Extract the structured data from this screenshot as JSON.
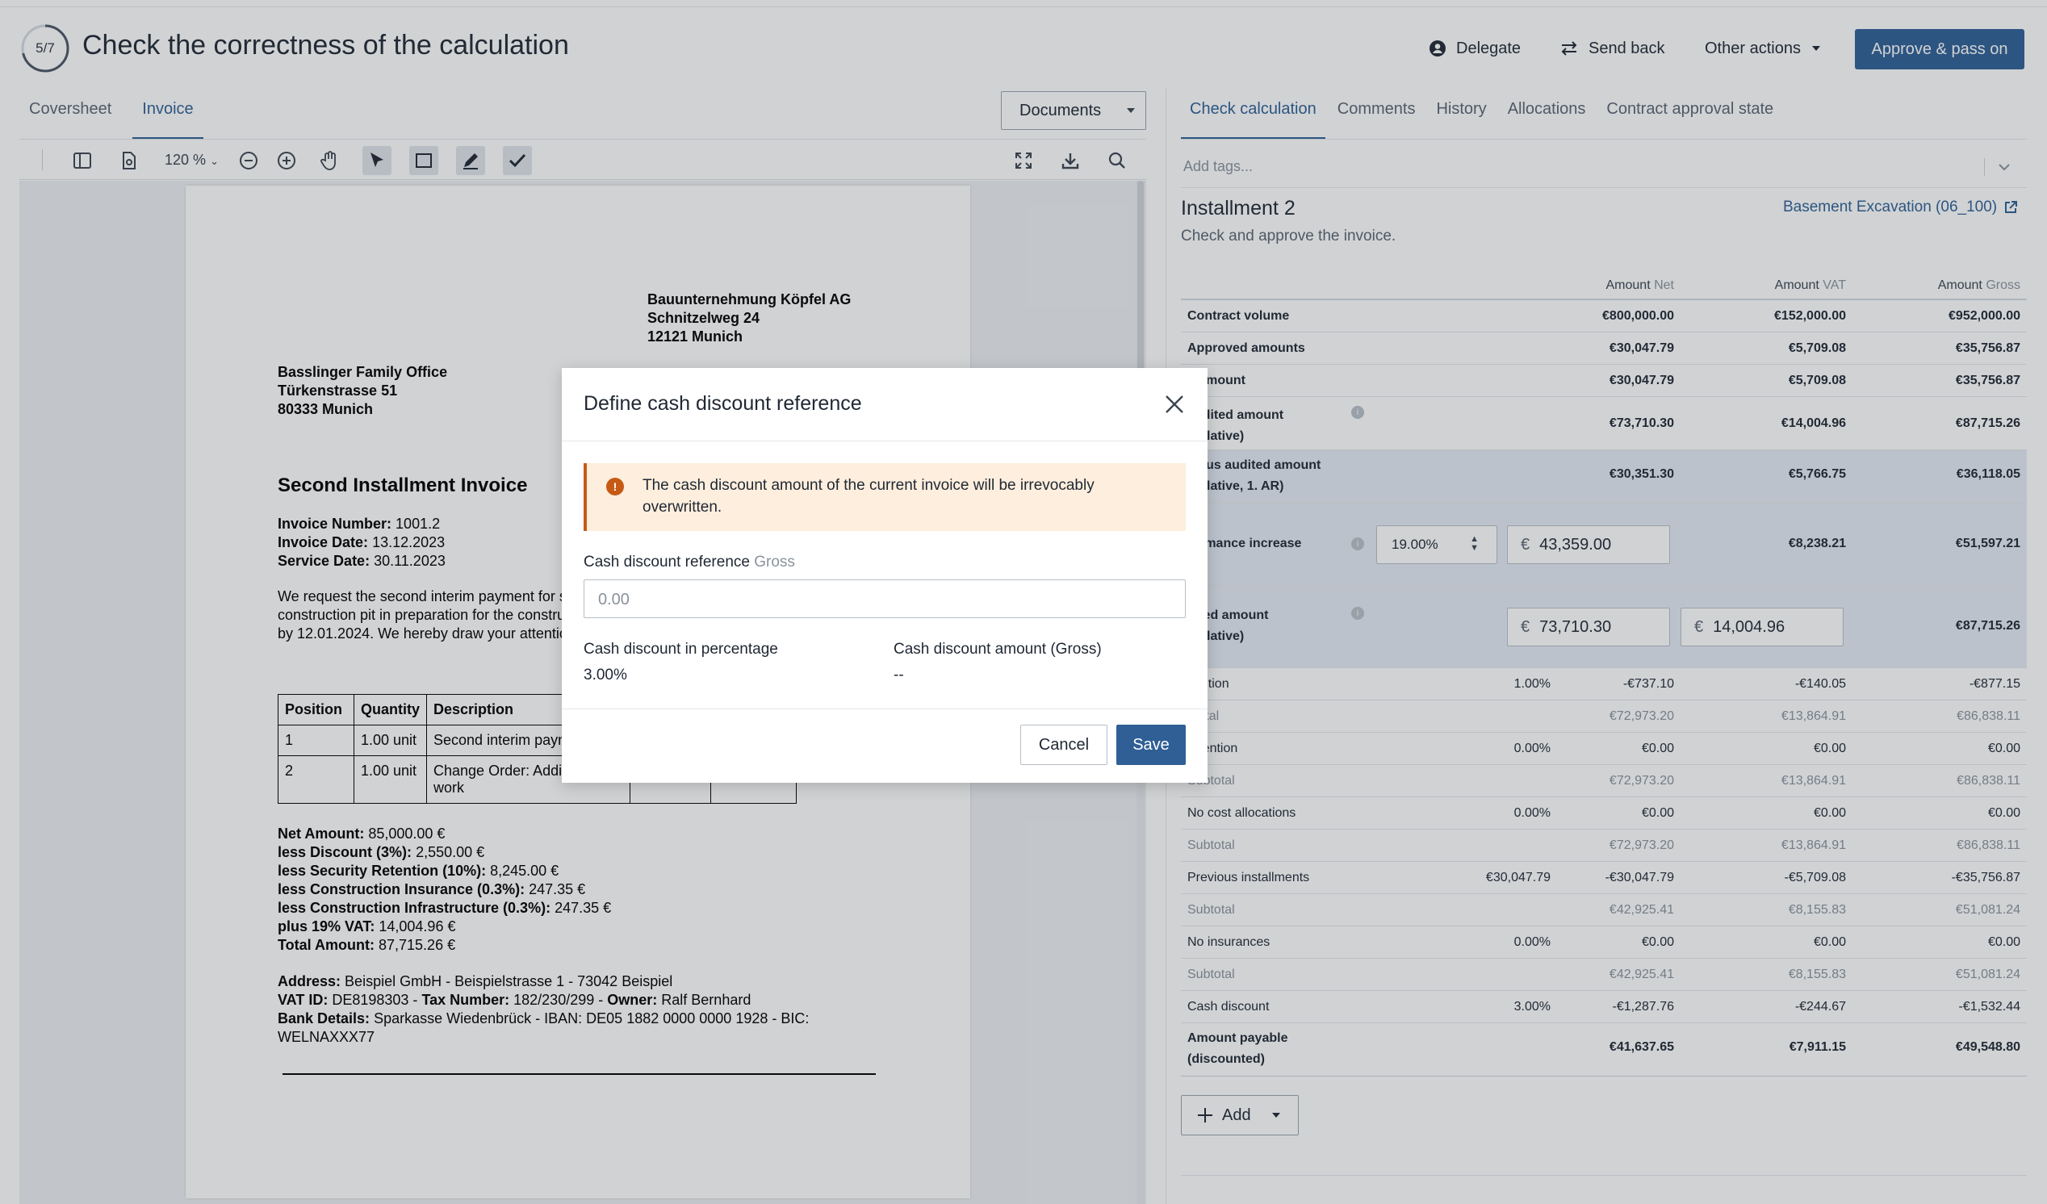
{
  "header": {
    "progress": "5/7",
    "progress_value": 0.714,
    "title": "Check the correctness of the calculation",
    "delegate": "Delegate",
    "send_back": "Send back",
    "other_actions": "Other actions",
    "approve": "Approve & pass on"
  },
  "left_tabs": [
    "Coversheet",
    "Invoice"
  ],
  "documents_label": "Documents",
  "toolbar": {
    "zoom": "120 %"
  },
  "invoice": {
    "recipient": [
      "Bauunternehmung Köpfel AG",
      "Schnitzelweg 24",
      "12121 Munich"
    ],
    "sender": [
      "Basslinger Family Office",
      "Türkenstrasse 51",
      "80333 Munich"
    ],
    "doc_title": "Second Installment Invoice",
    "meta": [
      {
        "k": "Invoice Number:",
        "v": "1001.2"
      },
      {
        "k": "Invoice Date:",
        "v": "13.12.2023"
      },
      {
        "k": "Service Date:",
        "v": "30.11.2023"
      }
    ],
    "body_lines": [
      "We request the second interim payment for se",
      "construction pit in preparation for the construc",
      "by 12.01.2024. We hereby draw your attentio"
    ],
    "table_headers": [
      "Position",
      "Quantity",
      "Description"
    ],
    "table_rows": [
      {
        "pos": "1",
        "qty": "1.00 unit",
        "desc": "Second interim paym"
      },
      {
        "pos": "2",
        "qty": "1.00 unit",
        "desc": "Change Order: Addit",
        "desc2": "work"
      }
    ],
    "totals": [
      {
        "k": "Net Amount:",
        "v": "85,000.00 €"
      },
      {
        "k": "less Discount (3%):",
        "v": "2,550.00 €"
      },
      {
        "k": "less Security Retention (10%):",
        "v": "8,245.00 €"
      },
      {
        "k": "less Construction Insurance (0.3%):",
        "v": "247.35 €"
      },
      {
        "k": "less Construction Infrastructure (0.3%):",
        "v": "247.35 €"
      },
      {
        "k": "plus 19% VAT:",
        "v": "14,004.96 €"
      },
      {
        "k": "Total Amount:",
        "v": "87,715.26 €"
      }
    ],
    "address_k": "Address:",
    "address_v": "Beispiel GmbH - Beispielstrasse 1 - 73042 Beispiel",
    "vat_k": "VAT ID:",
    "vat_v": "DE8198303 -",
    "tax_k": "Tax Number:",
    "tax_v": "182/230/299 -",
    "owner_k": "Owner:",
    "owner_v": "Ralf Bernhard",
    "bank_k": "Bank Details:",
    "bank_v": "Sparkasse Wiedenbrück - IBAN: DE05 1882 0000 0000 1928 - BIC:",
    "bank_v2": "WELNAXXX77"
  },
  "right_tabs": [
    "Check calculation",
    "Comments",
    "History",
    "Allocations",
    "Contract approval state"
  ],
  "tags_placeholder": "Add tags...",
  "installment": {
    "title": "Installment 2",
    "subtitle": "Check and approve the invoice.",
    "link": "Basement Excavation (06_100)"
  },
  "calc_headers": {
    "net_a": "Amount",
    "net_b": "Net",
    "vat_a": "Amount",
    "vat_b": "VAT",
    "gross_a": "Amount",
    "gross_b": "Gross"
  },
  "rows": {
    "contract": {
      "label": "Contract volume",
      "net": "€800,000.00",
      "vat": "€152,000.00",
      "gross": "€952,000.00"
    },
    "approved": {
      "label": "Approved amounts",
      "net": "€30,047.79",
      "vat": "€5,709.08",
      "gross": "€35,756.87"
    },
    "paid": {
      "label": "d amount",
      "net": "€30,047.79",
      "vat": "€5,709.08",
      "gross": "€35,756.87"
    },
    "audited_cum": {
      "label1": "audited amount",
      "label2": "mulative)",
      "net": "€73,710.30",
      "vat": "€14,004.96",
      "gross": "€87,715.26"
    },
    "prev_audited": {
      "label1": "vious audited amount",
      "label2": "mulative, 1. AR)",
      "net": "€30,351.30",
      "vat": "€5,766.75",
      "gross": "€36,118.05"
    },
    "perf_increase": {
      "label": "formance increase",
      "pct": "19.00%",
      "net_input": "43,359.00",
      "vat": "€8,238.21",
      "gross": "€51,597.21"
    },
    "audited": {
      "label1": "dited amount",
      "label2": "mulative)",
      "net_input": "73,710.30",
      "vat_input": "14,004.96",
      "gross": "€87,715.26"
    },
    "reduction": {
      "label": "duction",
      "pct": "1.00%",
      "net": "-€737.10",
      "vat": "-€140.05",
      "gross": "-€877.15"
    },
    "subtotal1": {
      "label": "btotal",
      "net": "€72,973.20",
      "vat": "€13,864.91",
      "gross": "€86,838.11"
    },
    "retention": {
      "label": "retention",
      "pct": "0.00%",
      "net": "€0.00",
      "vat": "€0.00",
      "gross": "€0.00"
    },
    "subtotal2": {
      "label": "Subtotal",
      "net": "€72,973.20",
      "vat": "€13,864.91",
      "gross": "€86,838.11"
    },
    "cost_alloc": {
      "label": "No cost allocations",
      "pct": "0.00%",
      "net": "€0.00",
      "vat": "€0.00",
      "gross": "€0.00"
    },
    "subtotal3": {
      "label": "Subtotal",
      "net": "€72,973.20",
      "vat": "€13,864.91",
      "gross": "€86,838.11"
    },
    "prev_inst": {
      "label": "Previous installments",
      "pct": "€30,047.79",
      "net": "-€30,047.79",
      "vat": "-€5,709.08",
      "gross": "-€35,756.87"
    },
    "subtotal4": {
      "label": "Subtotal",
      "net": "€42,925.41",
      "vat": "€8,155.83",
      "gross": "€51,081.24"
    },
    "insurances": {
      "label": "No insurances",
      "pct": "0.00%",
      "net": "€0.00",
      "vat": "€0.00",
      "gross": "€0.00"
    },
    "subtotal5": {
      "label": "Subtotal",
      "net": "€42,925.41",
      "vat": "€8,155.83",
      "gross": "€51,081.24"
    },
    "cash_discount": {
      "label": "Cash discount",
      "pct": "3.00%",
      "net": "-€1,287.76",
      "vat": "-€244.67",
      "gross": "-€1,532.44"
    },
    "payable": {
      "label1": "Amount payable",
      "label2": "(discounted)",
      "net": "€41,637.65",
      "vat": "€7,911.15",
      "gross": "€49,548.80"
    }
  },
  "currency_symbol": "€",
  "add_label": "Add",
  "modal": {
    "title": "Define cash discount reference",
    "warning": "The cash discount amount of the current invoice will be irrevocably overwritten.",
    "ref_label": "Cash discount reference",
    "ref_label_muted": "Gross",
    "ref_placeholder": "0.00",
    "pct_label": "Cash discount in percentage",
    "pct_value": "3.00%",
    "amount_label": "Cash discount amount (Gross)",
    "amount_value": "--",
    "cancel": "Cancel",
    "save": "Save"
  },
  "colors": {
    "accent": "#2f5f95",
    "warning": "#c65a15",
    "warning_bg": "#fdeedd",
    "row_highlight": "#e4ebf4"
  }
}
